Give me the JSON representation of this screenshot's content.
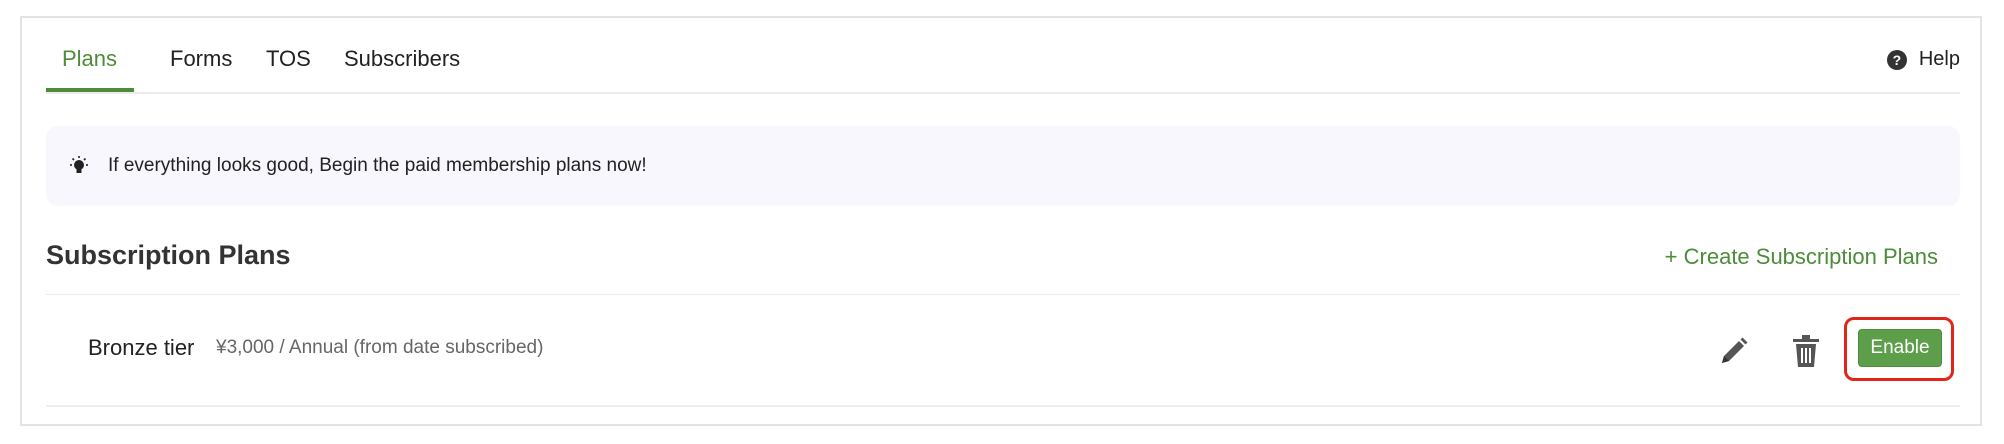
{
  "tabs": [
    {
      "label": "Plans",
      "active": true
    },
    {
      "label": "Forms",
      "active": false
    },
    {
      "label": "TOS",
      "active": false
    },
    {
      "label": "Subscribers",
      "active": false
    }
  ],
  "help": {
    "label": "Help",
    "icon": "question-circle-icon"
  },
  "notice": {
    "icon": "lightbulb-icon",
    "text": "If everything looks good, Begin the paid membership plans now!"
  },
  "section": {
    "title": "Subscription Plans",
    "create_label": "+ Create Subscription Plans"
  },
  "plans": [
    {
      "name": "Bronze tier",
      "price": "¥3,000 / Annual (from date subscribed)",
      "actions": {
        "edit_icon": "pencil-icon",
        "delete_icon": "trash-icon",
        "enable_label": "Enable"
      }
    }
  ],
  "colors": {
    "accent": "#4c8c3a",
    "button": "#5d9e4b",
    "highlight": "#e0261b",
    "notice_bg": "#f7f7fd"
  }
}
